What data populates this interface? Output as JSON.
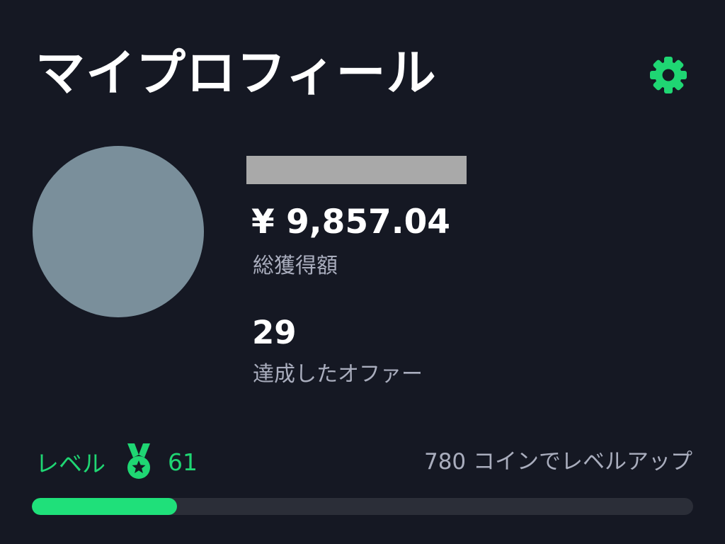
{
  "header": {
    "title": "マイプロフィール",
    "settings_icon": "gear-icon"
  },
  "profile": {
    "avatar_icon": "avatar-placeholder",
    "total_earned": "¥ 9,857.04",
    "total_earned_label": "総獲得額",
    "completed_offers": "29",
    "completed_offers_label": "達成したオファー"
  },
  "level": {
    "label": "レベル",
    "icon": "medal-icon",
    "value": "61",
    "next_level_text": "780 コインでレベルアップ",
    "progress_fraction": 0.22
  },
  "colors": {
    "background": "#151823",
    "accent": "#1fd673",
    "muted_text": "#a9adbd",
    "track": "#2b2e38"
  }
}
